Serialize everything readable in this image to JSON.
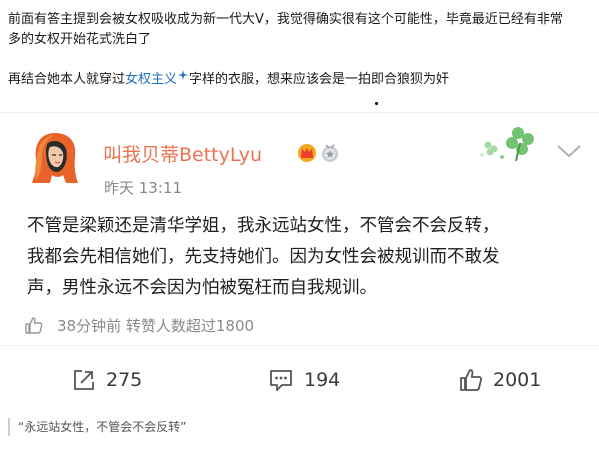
{
  "article": {
    "para1_line1": "前面有答主提到会被女权吸收成为新一代大V，我觉得确实很有这个可能性，毕竟最近已经有非常",
    "para1_line2": "多的女权开始花式洗白了",
    "para2_before": "再结合她本人就穿过",
    "para2_link": "女权主义",
    "para2_after": "字样的衣服，想来应该会是一拍即合狼狈为奸"
  },
  "post": {
    "username": "叫我贝蒂BettyLyu",
    "time": "昨天 13:11",
    "body_lines": [
      "不管是梁颖还是清华学姐，我永远站女性，不管会不会反转，",
      "我都会先相信她们，先支持她们。因为女性会被规训而不敢发",
      "声，男性永远不会因为怕被冤枉而自我规训。"
    ],
    "meta_text": "38分钟前  转赞人数超过1800",
    "actions": {
      "repost": "275",
      "comment": "194",
      "like": "2001"
    },
    "icons": {
      "avatar": "avatar-image",
      "badge1": "vip-crown-icon",
      "badge2": "level-medal-icon",
      "decoration": "clover-decoration-icon",
      "menu": "chevron-down-icon",
      "meta": "thumbs-up-icon",
      "repost": "repost-icon",
      "comment": "comment-icon",
      "like": "like-icon"
    },
    "colors": {
      "username": "#eb7350",
      "link": "#1f6fc2",
      "muted": "#888888"
    }
  },
  "caption": "“永远站女性，不管会不会反转”"
}
